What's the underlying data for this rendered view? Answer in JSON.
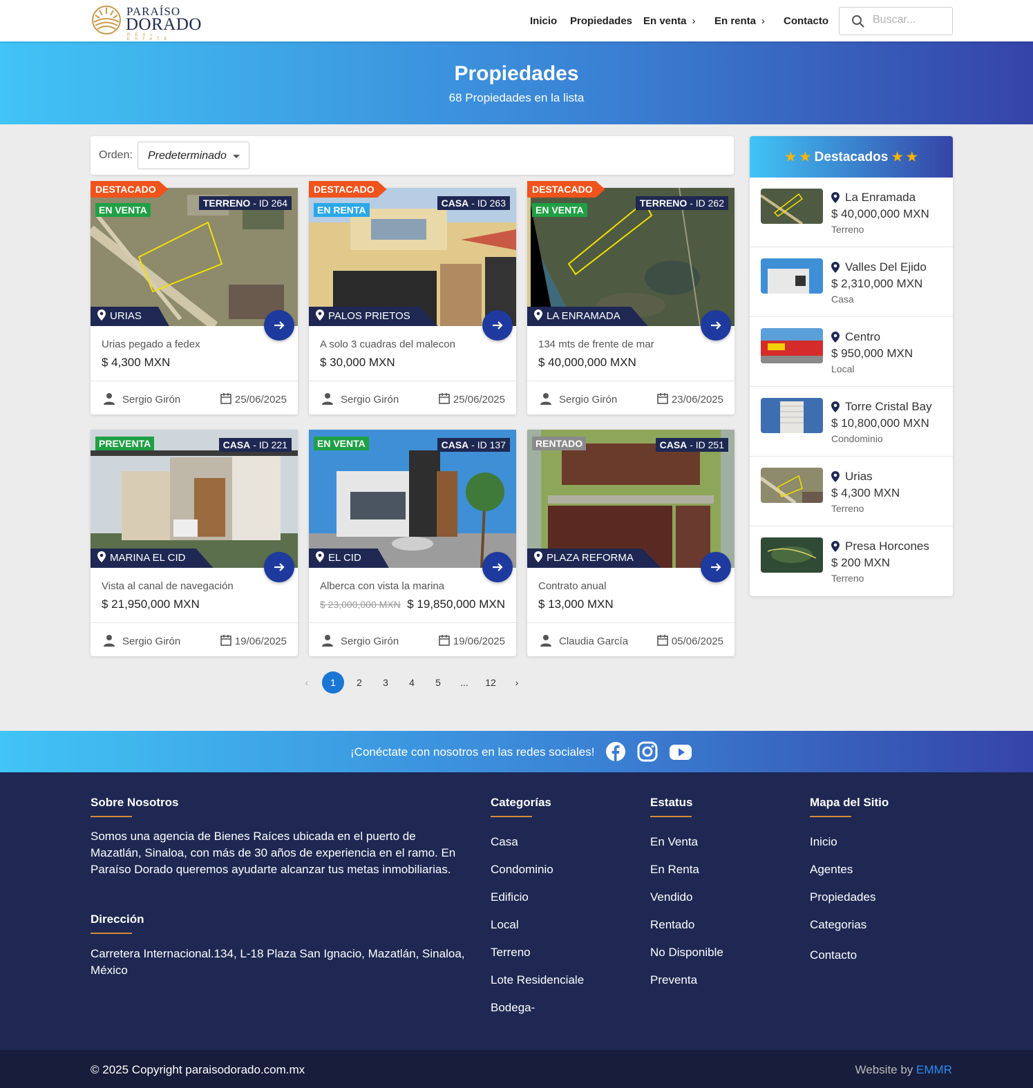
{
  "header": {
    "logo": {
      "line1": "PARAÍSO",
      "line2": "DORADO",
      "line3": "REAL ESTATE"
    },
    "nav": [
      {
        "label": "Inicio"
      },
      {
        "label": "Propiedades"
      },
      {
        "label": "En venta"
      },
      {
        "label": "En renta"
      },
      {
        "label": "Contacto"
      }
    ],
    "search_placeholder": "Buscar..."
  },
  "banner": {
    "title": "Propiedades",
    "subtitle": "68 Propiedades en la lista"
  },
  "toolbar": {
    "order_label": "Orden:",
    "order_value": "Predeterminado"
  },
  "listings": [
    {
      "ribbon": "DESTACADO",
      "status": "EN VENTA",
      "status_color": "#1fa045",
      "type": "TERRENO",
      "id": "- ID 264",
      "location": "URIAS",
      "desc": "Urias pegado a fedex",
      "price": "$ 4,300 MXN",
      "agent": "Sergio Girón",
      "date": "25/06/2025"
    },
    {
      "ribbon": "DESTACADO",
      "status": "EN RENTA",
      "status_color": "#2aa8e8",
      "type": "CASA",
      "id": "- ID 263",
      "location": "PALOS PRIETOS",
      "desc": "A solo 3 cuadras del malecon",
      "price": "$ 30,000 MXN",
      "agent": "Sergio Girón",
      "date": "25/06/2025"
    },
    {
      "ribbon": "DESTACADO",
      "status": "EN VENTA",
      "status_color": "#1fa045",
      "type": "TERRENO",
      "id": "- ID 262",
      "location": "LA ENRAMADA",
      "desc": "134 mts de frente de mar",
      "price": "$ 40,000,000 MXN",
      "agent": "Sergio Girón",
      "date": "23/06/2025"
    },
    {
      "ribbon": "",
      "status": "PREVENTA",
      "status_color": "#1fa045",
      "type": "CASA",
      "id": "- ID 221",
      "location": "MARINA EL CID",
      "desc": "Vista al canal de navegación",
      "price": "$ 21,950,000 MXN",
      "agent": "Sergio Girón",
      "date": "19/06/2025"
    },
    {
      "ribbon": "",
      "status": "EN VENTA",
      "status_color": "#1fa045",
      "type": "CASA",
      "id": "- ID 137",
      "location": "EL CID",
      "desc": "Alberca con vista la marina",
      "old_price": "$ 23,000,000 MXN",
      "price": "$ 19,850,000 MXN",
      "agent": "Sergio Girón",
      "date": "19/06/2025"
    },
    {
      "ribbon": "",
      "status": "RENTADO",
      "status_color": "#8a8a8a",
      "type": "CASA",
      "id": "- ID 251",
      "location": "PLAZA REFORMA",
      "desc": "Contrato anual",
      "price": "$ 13,000 MXN",
      "agent": "Claudia García",
      "date": "05/06/2025"
    }
  ],
  "pagination": {
    "prev": "‹",
    "pages": [
      "1",
      "2",
      "3",
      "4",
      "5",
      "...",
      "12"
    ],
    "next": "›",
    "active": "1"
  },
  "featured": {
    "title": "Destacados",
    "items": [
      {
        "name": "La Enramada",
        "price": "$ 40,000,000 MXN",
        "type": "Terreno"
      },
      {
        "name": "Valles Del Ejido",
        "price": "$ 2,310,000 MXN",
        "type": "Casa"
      },
      {
        "name": "Centro",
        "price": "$ 950,000 MXN",
        "type": "Local"
      },
      {
        "name": "Torre Cristal Bay",
        "price": "$ 10,800,000 MXN",
        "type": "Condominio"
      },
      {
        "name": "Urias",
        "price": "$ 4,300 MXN",
        "type": "Terreno"
      },
      {
        "name": "Presa Horcones",
        "price": "$ 200 MXN",
        "type": "Terreno"
      }
    ]
  },
  "social": {
    "text": "¡Conéctate con nosotros en las redes sociales!"
  },
  "footer": {
    "about_title": "Sobre Nosotros",
    "about_text": "Somos una agencia de Bienes Raíces ubicada en el puerto de Mazatlán, Sinaloa, con más de 30 años de experiencia en el ramo. En Paraíso Dorado queremos ayudarte alcanzar tus metas inmobiliarias.",
    "address_title": "Dirección",
    "address_text": "Carretera Internacional.134, L-18 Plaza San Ignacio, Mazatlán, Sinaloa, México",
    "categories_title": "Categorías",
    "categories": [
      "Casa",
      "Condominio",
      "Edificio",
      "Local",
      "Terreno",
      "Lote Residenciale",
      "Bodega-"
    ],
    "status_title": "Estatus",
    "status": [
      "En Venta",
      "En Renta",
      "Vendido",
      "Rentado",
      "No Disponible",
      "Preventa"
    ],
    "sitemap_title": "Mapa del Sitio",
    "sitemap": [
      "Inicio",
      "Agentes",
      "Propiedades",
      "Categorias",
      "Contacto"
    ],
    "copyright": "© 2025 Copyright paraisodorado.com.mx",
    "credit_prefix": "Website by",
    "credit_link": "EMMR"
  }
}
